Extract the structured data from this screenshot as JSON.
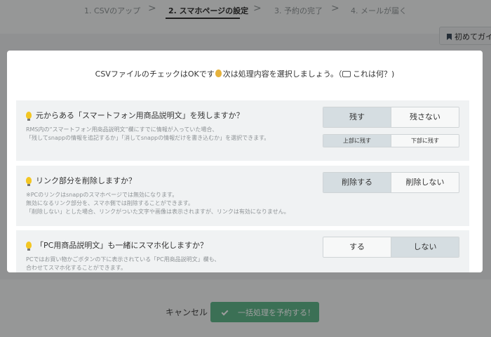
{
  "steps": [
    {
      "label": "1. CSVのアップ"
    },
    {
      "label": "2. スマホページの設定"
    },
    {
      "label": "3. 予約の完了"
    },
    {
      "label": "4. メールが届く"
    }
  ],
  "step_separator": ">",
  "guide_button": {
    "label": "初めてガイ"
  },
  "modal": {
    "header_prefix": "CSVファイルのチェックはOKです",
    "header_suffix": "次は処理内容を選択しましょう。（",
    "header_help": "これは何？)",
    "sections": [
      {
        "question": "元からある「スマートフォン用商品説明文」を残しますか？",
        "desc": [
          "RMS内の“スマートフォン用商品説明文”欄にすでに情報が入っていた場合、",
          "「残してsnappの情報を追記するか」「消してsnappの情報だけを書き込むか」を選択できます。"
        ],
        "options": [
          "残す",
          "残さない"
        ],
        "selected": "残す",
        "sub_options": [
          "上部に残す",
          "下部に残す"
        ],
        "sub_selected": "上部に残す"
      },
      {
        "question": "リンク部分を削除しますか？",
        "desc": [
          "※PCのリンクはsnappのスマホページでは無効になります。",
          "無効になるリンク部分を、スマホ側では削除することができます。",
          "「削除しない」とした場合、リンクがついた文字や画像は表示されますが、リンクは有効になりません。"
        ],
        "options": [
          "削除する",
          "削除しない"
        ],
        "selected": "削除する"
      },
      {
        "question": "「PC用商品説明文」も一緒にスマホ化しますか？",
        "desc": [
          "PCではお買い物かごボタンの下に表示されている「PC用商品説明文」欄も、",
          "合わせてスマホ化することができます。"
        ],
        "options": [
          "する",
          "しない"
        ],
        "selected": "しない"
      }
    ]
  },
  "footer": {
    "cancel_label": "キャンセル",
    "submit_label": "一括処理を予約する！"
  },
  "colors": {
    "accent": "#5fb58a",
    "selected_option": "#d5dde1",
    "bulb": "#f3c623"
  }
}
